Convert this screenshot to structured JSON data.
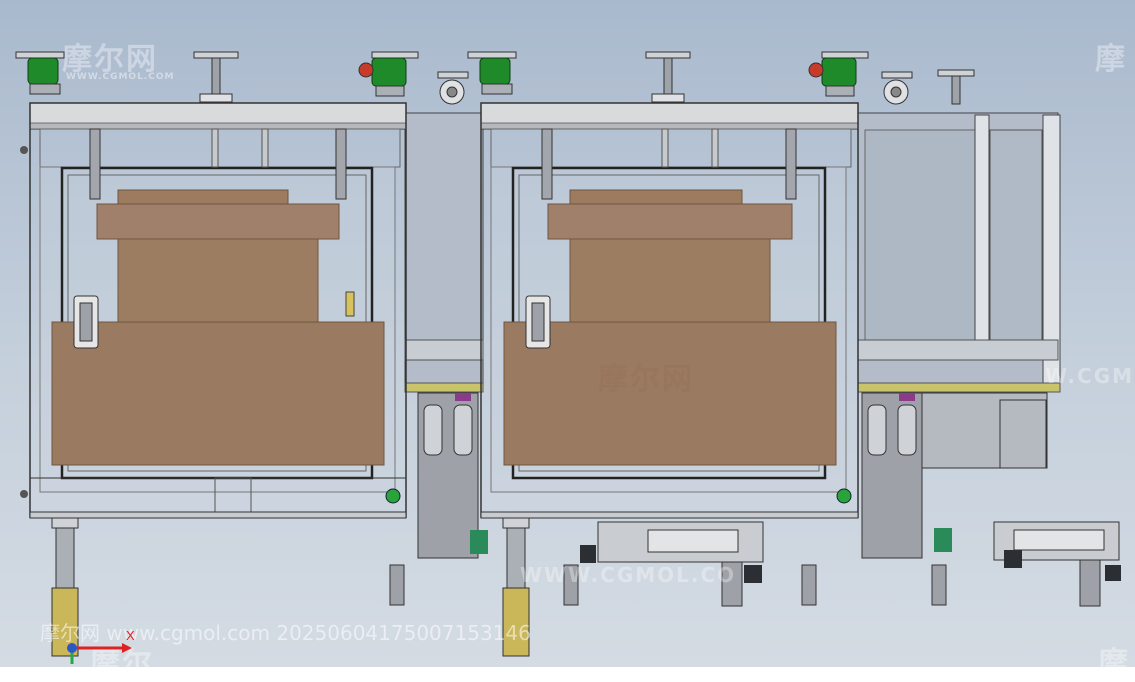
{
  "viewer": {
    "background_top": "#a9b9cd",
    "background_bottom": "#d4dbe3"
  },
  "watermarks": {
    "brand_cn": "摩尔网",
    "brand_en": "WWW.CGMOL.COM",
    "brand_cn_partial": "摩尔",
    "brand_cn_partial_2": "摩",
    "url_partial": "WWW.CGMOL.CO",
    "url_partial_right": "W.CGM",
    "footer": "摩尔网 www.cgmol.com 20250604175007153146"
  },
  "triad": {
    "x_label": "X",
    "icon": "coordinate-triad-icon"
  },
  "model": {
    "frame_color": "#d8d8d8",
    "panel_color": "#b9c1cc",
    "carton_color": "#9a7a5e",
    "green_foot_color": "#1f8a2a",
    "accent_purple": "#8a3c8a"
  }
}
